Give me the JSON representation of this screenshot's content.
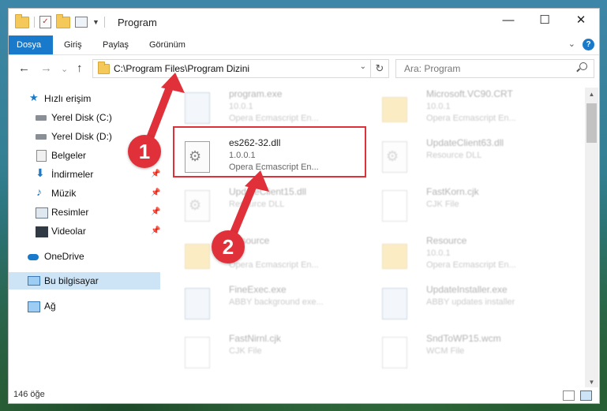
{
  "window": {
    "title": "Program",
    "controls": [
      "—",
      "☐",
      "✕"
    ]
  },
  "ribbon": {
    "tabs": [
      "Dosya",
      "Giriş",
      "Paylaş",
      "Görünüm"
    ],
    "help": "?"
  },
  "nav": {
    "back": "←",
    "forward": "→",
    "recent": "⌄",
    "up": "↑",
    "address": "C:\\Program Files\\Program Dizini",
    "refresh": "↻",
    "search_placeholder": "Ara: Program"
  },
  "sidebar": {
    "items": [
      {
        "label": "Hızlı erişim",
        "icon": "star-icon"
      },
      {
        "label": "Yerel Disk (C:)",
        "icon": "drive-icon"
      },
      {
        "label": "Yerel Disk (D:)",
        "icon": "drive-icon"
      },
      {
        "label": "Belgeler",
        "icon": "documents-icon"
      },
      {
        "label": "İndirmeler",
        "icon": "downloads-icon"
      },
      {
        "label": "Müzik",
        "icon": "music-icon"
      },
      {
        "label": "Resimler",
        "icon": "pictures-icon"
      },
      {
        "label": "Videolar",
        "icon": "videos-icon"
      },
      {
        "label": "OneDrive",
        "icon": "cloud-icon"
      },
      {
        "label": "Bu bilgisayar",
        "icon": "computer-icon"
      },
      {
        "label": "Ağ",
        "icon": "network-icon"
      }
    ]
  },
  "files": [
    {
      "name": "program.exe",
      "line2": "10.0.1",
      "line3": "Opera Ecmascript En...",
      "icon": "exe-icon"
    },
    {
      "name": "Microsoft.VC90.CRT",
      "line2": "10.0.1",
      "line3": "Opera Ecmascript En...",
      "icon": "folder-icon"
    },
    {
      "name": "es262-32.dll",
      "line2": "1.0.0.1",
      "line3": "Opera Ecmascript En...",
      "icon": "dll-icon"
    },
    {
      "name": "UpdateClient63.dll",
      "line2": "Resource DLL",
      "line3": "",
      "icon": "dll-icon"
    },
    {
      "name": "UpdateClient15.dll",
      "line2": "Resource DLL",
      "line3": "",
      "icon": "dll-icon"
    },
    {
      "name": "FastKorn.cjk",
      "line2": "CJK File",
      "line3": "",
      "icon": "file-icon"
    },
    {
      "name": "Resource",
      "line2": "",
      "line3": "Opera Ecmascript En...",
      "icon": "folder-icon"
    },
    {
      "name": "Resource",
      "line2": "10.0.1",
      "line3": "Opera Ecmascript En...",
      "icon": "folder-icon"
    },
    {
      "name": "FineExec.exe",
      "line2": "ABBY background exe...",
      "line3": "",
      "icon": "exe-icon"
    },
    {
      "name": "UpdateInstaller.exe",
      "line2": "ABBY updates installer",
      "line3": "",
      "icon": "exe-icon"
    },
    {
      "name": "FastNirnl.cjk",
      "line2": "CJK File",
      "line3": "",
      "icon": "file-icon"
    },
    {
      "name": "SndToWP15.wcm",
      "line2": "WCM File",
      "line3": "",
      "icon": "file-icon"
    }
  ],
  "status": {
    "count": "146 öğe"
  },
  "annotations": {
    "step1": "1",
    "step2": "2",
    "accent": "#e0313a"
  },
  "colors": {
    "ribbon_active": "#1979ca",
    "selection": "#cde4f7"
  }
}
